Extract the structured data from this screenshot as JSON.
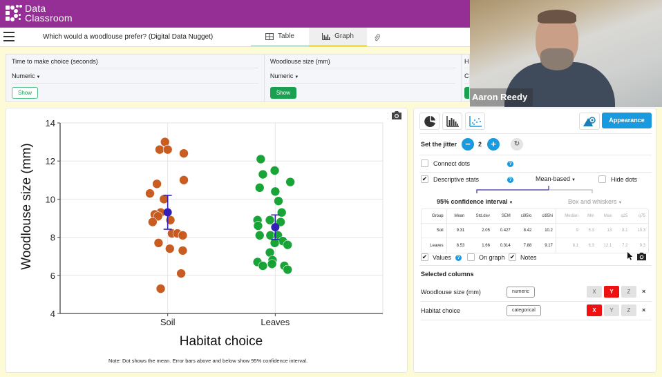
{
  "app": {
    "logo_line1": "Data",
    "logo_line2": "Classroom",
    "brand_color": "#952f96"
  },
  "navbar": {
    "menu_icon": "hamburger-menu-icon",
    "document_title": "Which would a woodlouse prefer? (Digital Data Nugget)",
    "tabs": [
      {
        "label": "Table",
        "icon": "table-icon",
        "active": false
      },
      {
        "label": "Graph",
        "icon": "bar-chart-icon",
        "active": true
      },
      {
        "label": "",
        "icon": "paperclip-icon",
        "active": false
      }
    ]
  },
  "variables": [
    {
      "name": "Time to make choice (seconds)",
      "type": "Numeric",
      "show_label": "Show",
      "shown": false
    },
    {
      "name": "Woodlouse size (mm)",
      "type": "Numeric",
      "show_label": "Show",
      "shown": true
    },
    {
      "name": "H",
      "type": "C",
      "show_label": "",
      "shown": true
    }
  ],
  "video": {
    "participant_name": "Aaron Reedy"
  },
  "chart_data": {
    "type": "scatter",
    "subtype": "categorical dot plot with mean and 95% CI",
    "xlabel": "Habitat choice",
    "ylabel": "Woodlouse size (mm)",
    "categories": [
      "Soil",
      "Leaves"
    ],
    "ylim": [
      4,
      14
    ],
    "yticks": [
      4,
      6,
      8,
      10,
      12,
      14
    ],
    "grid": true,
    "note": "Note: Dot shows the mean. Error bars above and below show 95% confidence interval.",
    "series": [
      {
        "name": "Soil",
        "color": "#c8581a",
        "values": [
          13.0,
          12.6,
          12.6,
          12.4,
          11.0,
          10.8,
          10.3,
          10.0,
          9.3,
          9.2,
          9.1,
          8.9,
          8.8,
          8.2,
          8.2,
          8.1,
          7.7,
          7.4,
          7.3,
          6.1,
          5.3
        ],
        "jitter": [
          -0.05,
          -0.15,
          0.0,
          0.3,
          0.3,
          -0.2,
          -0.33,
          -0.07,
          -0.13,
          -0.24,
          -0.18,
          0.05,
          -0.28,
          0.08,
          0.18,
          0.28,
          -0.17,
          0.04,
          0.28,
          0.25,
          -0.13
        ],
        "mean": 9.31,
        "ci_low": 8.42,
        "ci_high": 10.2
      },
      {
        "name": "Leaves",
        "color": "#12a232",
        "values": [
          12.1,
          11.5,
          11.3,
          10.9,
          10.6,
          10.4,
          9.9,
          9.3,
          8.9,
          8.9,
          8.8,
          8.6,
          8.1,
          8.1,
          8.1,
          7.8,
          7.7,
          7.6,
          7.2,
          6.8,
          6.7,
          6.6,
          6.5,
          6.5,
          6.3
        ],
        "jitter": [
          -0.27,
          -0.01,
          -0.23,
          0.28,
          -0.29,
          0.0,
          0.06,
          0.12,
          -0.33,
          -0.1,
          0.1,
          -0.32,
          -0.29,
          -0.09,
          0.05,
          0.14,
          -0.01,
          0.23,
          -0.1,
          -0.05,
          -0.33,
          -0.06,
          -0.23,
          0.17,
          0.23
        ],
        "mean": 8.53,
        "ci_low": 7.88,
        "ci_high": 9.17
      }
    ],
    "mean_marker_color": "#3020b8"
  },
  "controls": {
    "graph_type_icons": [
      "pie-chart-icon",
      "histogram-icon",
      "dot-plot-icon"
    ],
    "theme_icon": "palette-icon",
    "appearance_label": "Appearance",
    "jitter_label": "Set the jitter",
    "jitter_value": "2",
    "connect_dots_label": "Connect dots",
    "connect_dots_checked": false,
    "descriptive_stats_label": "Descriptive stats",
    "descriptive_stats_checked": true,
    "stats_mode": "Mean-based",
    "hide_dots_label": "Hide dots",
    "hide_dots_checked": false,
    "interval_option": "95% confidence interval",
    "box_option": "Box and whiskers",
    "stats_table": {
      "headers": [
        "Group",
        "Mean",
        "Std.dev",
        "SEM",
        "ci95lo",
        "ci95hi",
        "Median",
        "Min",
        "Max",
        "q25",
        "q75"
      ],
      "rows": [
        [
          "Soil",
          "9.31",
          "2.05",
          "0.427",
          "8.42",
          "10.2",
          "9",
          "5.3",
          "13",
          "8.1",
          "10.3"
        ],
        [
          "Leaves",
          "8.53",
          "1.66",
          "0.314",
          "7.88",
          "9.17",
          "8.1",
          "6.3",
          "12.1",
          "7.2",
          "9.3"
        ]
      ]
    },
    "values_label": "Values",
    "values_checked": true,
    "on_graph_label": "On graph",
    "on_graph_checked": false,
    "notes_label": "Notes",
    "notes_checked": true,
    "selected_columns_title": "Selected columns",
    "selected_columns": [
      {
        "name": "Woodlouse size (mm)",
        "type": "numeric",
        "axis": "Y"
      },
      {
        "name": "Habitat choice",
        "type": "categorical",
        "axis": "X"
      }
    ],
    "axis_options": [
      "X",
      "Y",
      "Z"
    ],
    "remove_symbol": "×"
  }
}
